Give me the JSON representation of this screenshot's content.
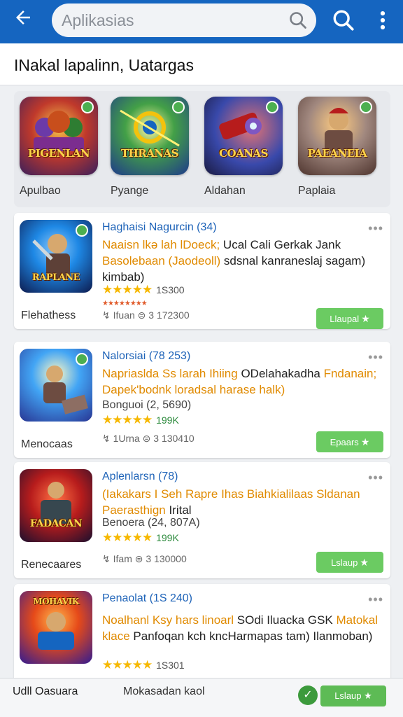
{
  "appbar": {
    "search_placeholder": "Aplikasias",
    "back_icon": "arrow-back-icon",
    "search_icon": "search-icon",
    "more_icon": "more-vert-icon",
    "color": "#1565c0"
  },
  "subheader": {
    "title": "INakal lapalinn, Uatargas"
  },
  "featured": [
    {
      "icon_text": "PIGENLAN",
      "label": "Apulbao"
    },
    {
      "icon_text": "THRANAS",
      "label": "Pyange"
    },
    {
      "icon_text": "COANAS",
      "label": "Aldahan"
    },
    {
      "icon_text": "PAEANEIA",
      "label": "Paplaia"
    }
  ],
  "cards": [
    {
      "icon_text": "RAPLANE",
      "title": "Haghaisi Nagurcin (34)",
      "desc_hl": "Naaisn lkə lah lDoeck;",
      "desc_1": " Ucal Cali Gerkak Jank",
      "desc_hl2": "Basolebaan (Jaodeoll)",
      "desc_2": " sdsnal kanraneslaj sagam) kimbab)",
      "rating_label": "",
      "rating_count": "1S300",
      "meta": "Ifuan   ⊜ 3 172300",
      "name": "Flehathess",
      "button": "Llaupal"
    },
    {
      "icon_text": "",
      "title": "Nalorsiai (78 253)",
      "desc_hl": "Napriaslda Ss larah Ihiing",
      "desc_1": " ODelahakadha",
      "desc_hl2": "Fndanain; Dapek'bodnk",
      "desc_2": " loradsal harase halk)",
      "sub": "Bonguoi (2, 5690)",
      "rating_count": "199K",
      "meta": "1Urna   ⊜ 3 130410",
      "name": "Menocaas",
      "button": "Epaars"
    },
    {
      "icon_text": "FADACAN",
      "title": "Aplenlarsn (78)",
      "desc_hl": "(Iakakars I Seh Rapre Ihas Biahkialilaas",
      "desc_1": "",
      "desc_hl2": "Sldanan Paerasthign",
      "desc_2": " Irital",
      "sub": "Benoera (24, 807A)",
      "rating_count": "199K",
      "meta": "Ifam   ⊜ 3 130000",
      "name": "Renecaares",
      "button": "Lslaup"
    },
    {
      "icon_text": "MOHAVIK",
      "title": "Penaolat (1S 240)",
      "desc_hl": "Noalhanl Ksy hars linoarl",
      "desc_1": " SOdi Iluacka GSK",
      "desc_hl2": "Matokal klace",
      "desc_2": " Panfoqan kch kncHarmapas tam) Ilanmoban)",
      "rating_count": "1S301",
      "meta": "",
      "name": "",
      "button": ""
    }
  ],
  "bottombar": {
    "left": "Udll Oasuara",
    "mid": "Mokasadan kaol",
    "button": "Lslaup"
  }
}
